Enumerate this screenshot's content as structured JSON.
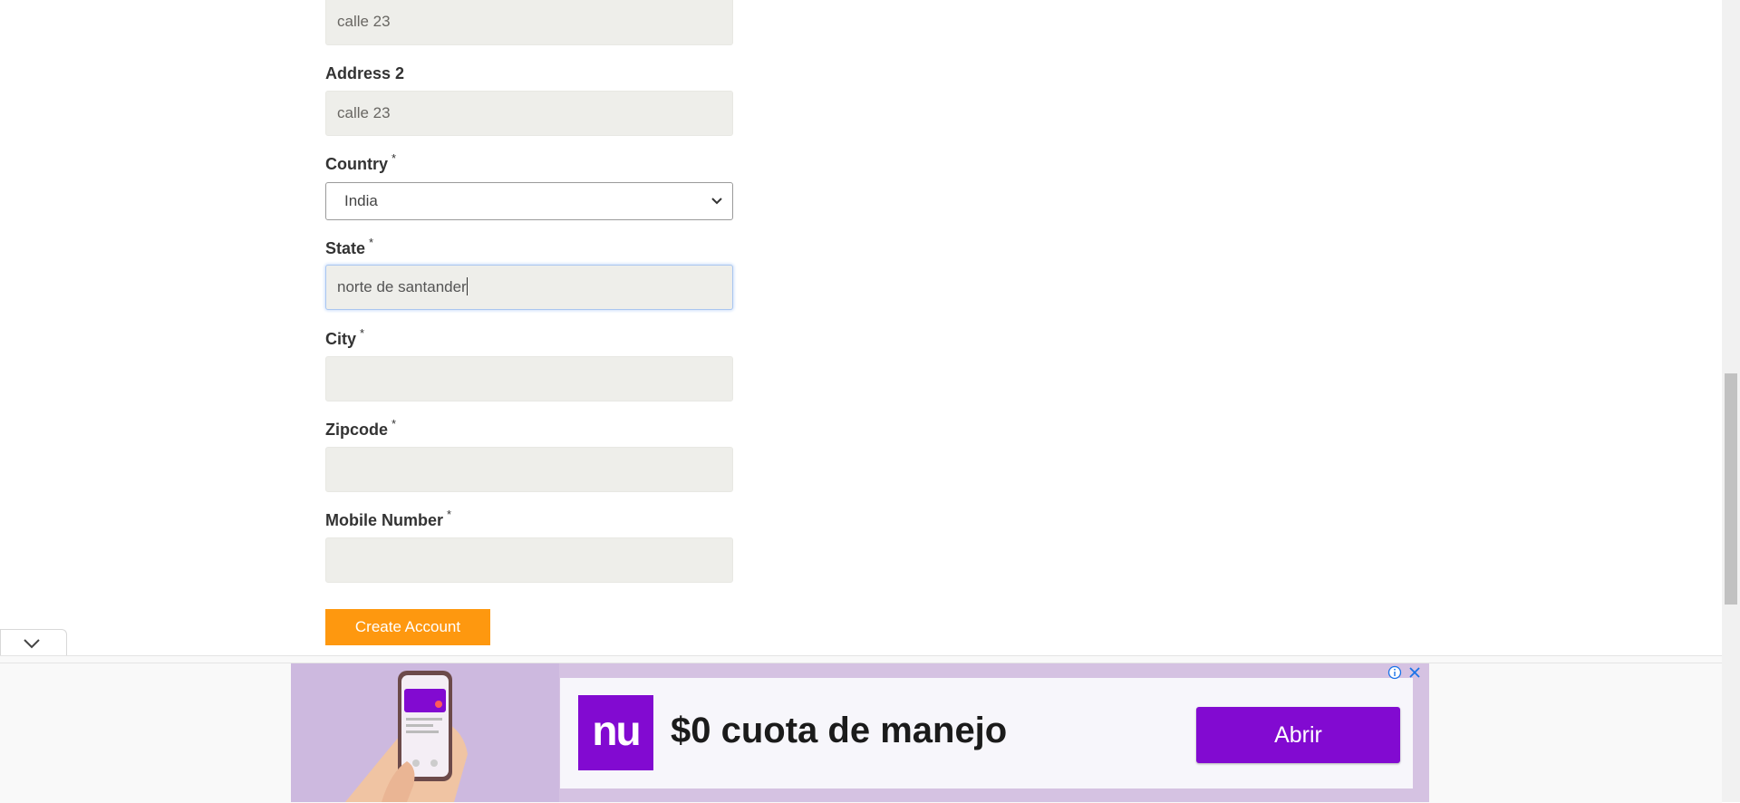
{
  "form": {
    "address1": {
      "value": "calle 23"
    },
    "address2": {
      "label": "Address 2",
      "value": "calle 23"
    },
    "country": {
      "label": "Country",
      "required": "*",
      "selected": "India"
    },
    "state": {
      "label": "State",
      "required": "*",
      "value": "norte de santander"
    },
    "city": {
      "label": "City",
      "required": "*",
      "value": ""
    },
    "zipcode": {
      "label": "Zipcode",
      "required": "*",
      "value": ""
    },
    "mobile": {
      "label": "Mobile Number",
      "required": "*",
      "value": ""
    },
    "submit_label": "Create Account"
  },
  "ad": {
    "logo_text": "nu",
    "headline": "$0 cuota de manejo",
    "cta_label": "Abrir",
    "brand_color": "#820ad1"
  },
  "colors": {
    "accent": "#fe980f",
    "input_bg": "#eeeeea"
  },
  "icons": [
    "chevron-down-icon",
    "info-icon",
    "close-icon",
    "collapse-chevron-icon"
  ]
}
